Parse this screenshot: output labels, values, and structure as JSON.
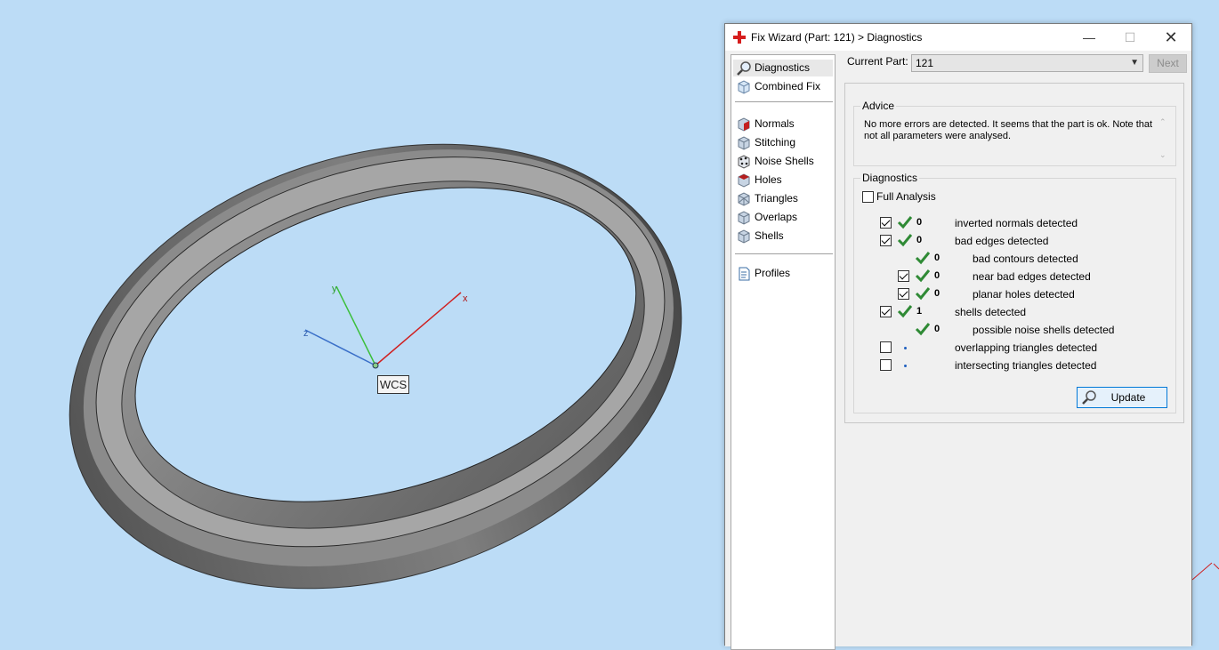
{
  "viewport": {
    "wcs_label": "WCS",
    "axes": {
      "x": "x",
      "y": "y",
      "z": "z"
    }
  },
  "dialog": {
    "title": "Fix Wizard (Part: 121) > Diagnostics",
    "window_buttons": {
      "minimize": "—",
      "maximize": "☐",
      "close": "✕"
    }
  },
  "nav": {
    "items": [
      {
        "label": "Diagnostics",
        "icon": "magnifier-icon",
        "selected": true
      },
      {
        "label": "Combined Fix",
        "icon": "cube-icon"
      },
      {
        "label": "Normals",
        "icon": "normals-cube-icon"
      },
      {
        "label": "Stitching",
        "icon": "stitching-cube-icon"
      },
      {
        "label": "Noise Shells",
        "icon": "noise-shells-icon"
      },
      {
        "label": "Holes",
        "icon": "holes-cube-icon"
      },
      {
        "label": "Triangles",
        "icon": "triangles-cube-icon"
      },
      {
        "label": "Overlaps",
        "icon": "overlaps-cube-icon"
      },
      {
        "label": "Shells",
        "icon": "shells-cube-icon"
      },
      {
        "label": "Profiles",
        "icon": "document-icon"
      }
    ]
  },
  "current_part": {
    "label": "Current Part:",
    "value": "121"
  },
  "next_label": "Next",
  "advice": {
    "title": "Advice",
    "text": "No more errors are detected. It seems that the part is ok. Note that not all parameters were analysed."
  },
  "diagnostics": {
    "title": "Diagnostics",
    "full_analysis": {
      "label": "Full Analysis",
      "checked": false
    },
    "rows": [
      {
        "checked": true,
        "status": "ok",
        "count": "0",
        "label": "inverted normals detected"
      },
      {
        "checked": true,
        "status": "ok",
        "count": "0",
        "label": "bad edges detected"
      },
      {
        "checkbox": false,
        "status": "ok",
        "count": "0",
        "label": "bad contours detected"
      },
      {
        "checked": true,
        "status": "ok",
        "count": "0",
        "label": "near bad edges detected"
      },
      {
        "checked": true,
        "status": "ok",
        "count": "0",
        "label": "planar holes detected"
      },
      {
        "checked": true,
        "status": "ok",
        "count": "1",
        "label": "shells detected"
      },
      {
        "checkbox": false,
        "status": "ok",
        "count": "0",
        "label": "possible noise shells detected"
      },
      {
        "checked": false,
        "status": "pending",
        "count": "",
        "label": "overlapping triangles detected"
      },
      {
        "checked": false,
        "status": "pending",
        "count": "",
        "label": "intersecting triangles detected"
      }
    ],
    "update_label": "Update"
  },
  "colors": {
    "viewport_bg": "#bcdcf6",
    "check_green": "#2f8a35",
    "accent_blue": "#0078d7"
  }
}
